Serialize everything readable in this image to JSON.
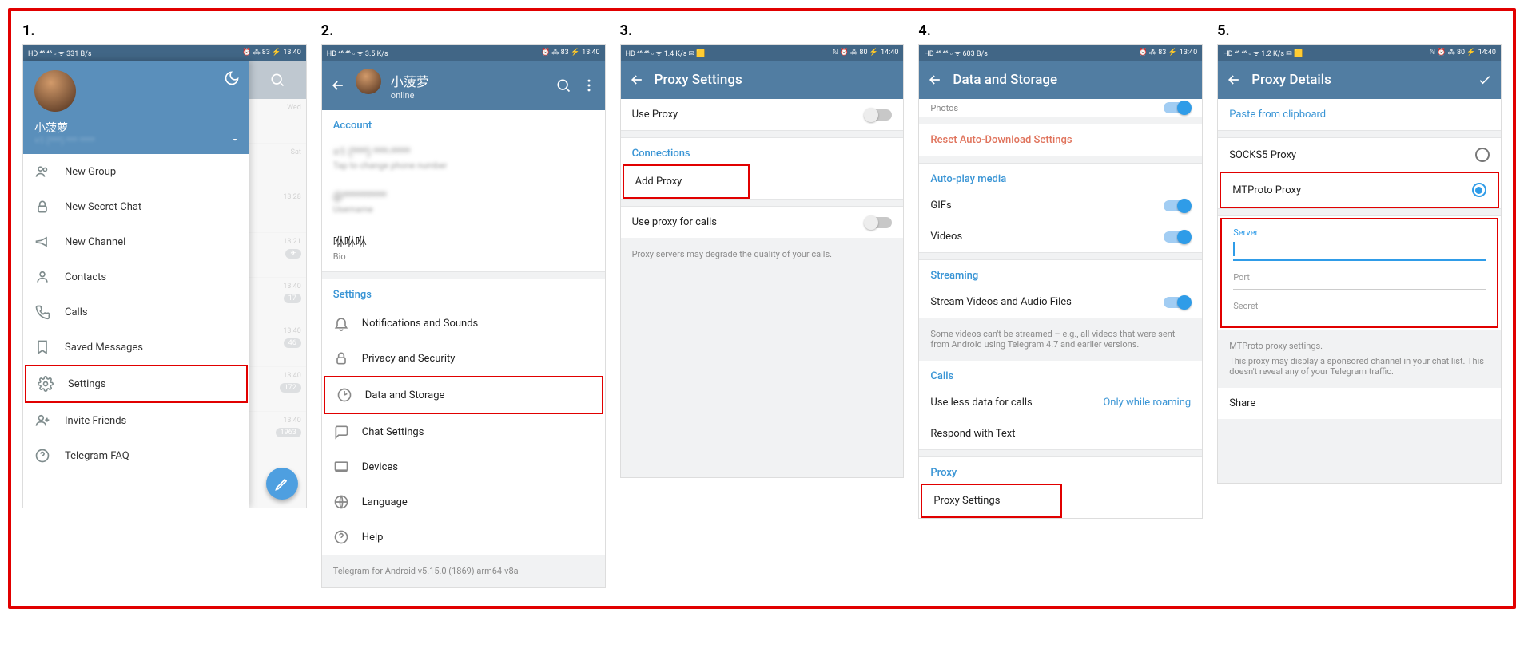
{
  "steps": [
    "1.",
    "2.",
    "3.",
    "4.",
    "5."
  ],
  "status": {
    "time_a": "13:40",
    "time_b": "14:40",
    "left_a": "HD ⁴⁶ ⁴⁶ ▫ ᯤ 331 B/s",
    "left_b": "HD ⁴⁶ ⁴⁶ ▫ ᯤ 3.5 K/s",
    "left_c": "HD ⁴⁶ ⁴⁶ ▫ ᯤ 1.4 K/s ✉ 🟨",
    "left_d": "HD ⁴⁶ ⁴⁶ ▫ ᯤ 603 B/s",
    "left_e": "HD ⁴⁶ ⁴⁶ ▫ ᯤ 1.2 K/s ✉ 🟨",
    "right_a": "⏰ ⁂ 83 ⚡",
    "right_b": "ℕ ⏰ ⁂ 80 ⚡"
  },
  "drawer": {
    "name": "小菠萝",
    "phone": "+1 (***) *** ****",
    "items": [
      "New Group",
      "New Secret Chat",
      "New Channel",
      "Contacts",
      "Calls",
      "Saved Messages",
      "Settings",
      "Invite Friends",
      "Telegram FAQ"
    ]
  },
  "chattimes": [
    "Wed",
    "Sat",
    "13:28",
    "13:21",
    "13:40",
    "13:40",
    "13:40",
    "13:40"
  ],
  "chatbadges": [
    "",
    "",
    "",
    "✈",
    "17",
    "46",
    "172",
    "1963"
  ],
  "panel2": {
    "title": "小菠萝",
    "subtitle": "online",
    "acct_header": "Account",
    "acc_phone": "+1 (***) ***-****",
    "acc_phone_sub": "Tap to change phone number",
    "acc_user": "@*********",
    "acc_user_sub": "Username",
    "acc_bio": "咻咻咻",
    "acc_bio_sub": "Bio",
    "settings_header": "Settings",
    "items": [
      "Notifications and Sounds",
      "Privacy and Security",
      "Data and Storage",
      "Chat Settings",
      "Devices",
      "Language",
      "Help"
    ],
    "footer": "Telegram for Android v5.15.0 (1869) arm64-v8a"
  },
  "panel3": {
    "title": "Proxy Settings",
    "use_proxy": "Use Proxy",
    "conn_header": "Connections",
    "add_proxy": "Add Proxy",
    "use_calls": "Use proxy for calls",
    "hint": "Proxy servers may degrade the quality of your calls."
  },
  "panel4": {
    "title": "Data and Storage",
    "photos": "Photos",
    "reset": "Reset Auto-Download Settings",
    "autoplay_header": "Auto-play media",
    "gifs": "GIFs",
    "videos": "Videos",
    "streaming_header": "Streaming",
    "stream_row": "Stream Videos and Audio Files",
    "stream_hint": "Some videos can't be streamed – e.g., all videos that were sent from Android using Telegram 4.7 and earlier versions.",
    "calls_header": "Calls",
    "use_less": "Use less data for calls",
    "use_less_val": "Only while roaming",
    "respond": "Respond with Text",
    "proxy_header": "Proxy",
    "proxy_settings": "Proxy Settings"
  },
  "panel5": {
    "title": "Proxy Details",
    "paste": "Paste from clipboard",
    "socks": "SOCKS5 Proxy",
    "mtproto": "MTProto Proxy",
    "server": "Server",
    "port": "Port",
    "secret": "Secret",
    "info1": "MTProto proxy settings.",
    "info2": "This proxy may display a sponsored channel in your chat list. This doesn't reveal any of your Telegram traffic.",
    "share": "Share"
  }
}
